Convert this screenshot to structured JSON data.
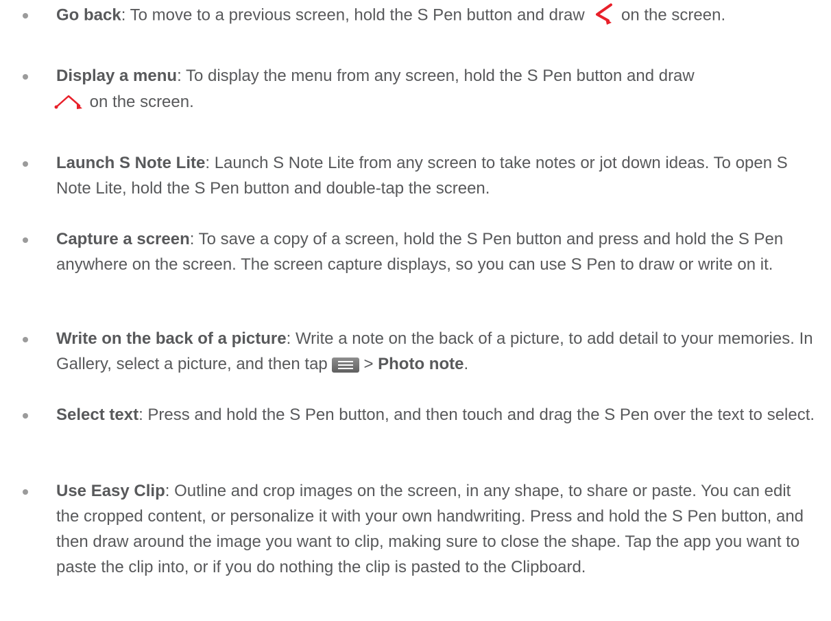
{
  "items": [
    {
      "term": "Go back",
      "text_before_icon": ": To move to a previous screen, hold the S Pen button and draw ",
      "icon": "back-gesture-icon",
      "text_after_icon": "on the screen."
    },
    {
      "term": "Display a menu",
      "text_before_icon": ": To display the menu from any screen, hold the S Pen button and draw",
      "icon": "menu-gesture-icon",
      "text_after_icon": " on the screen."
    },
    {
      "term": "Launch S Note Lite",
      "text": ": Launch S Note Lite from any screen to take notes or jot down ideas. To open S Note Lite, hold the S Pen button and double-tap the screen."
    },
    {
      "term": "Capture a screen",
      "text": ": To save a copy of a screen, hold the S Pen button and press and hold the S Pen anywhere on the screen. The screen capture displays, so you can use S Pen to draw or write on it."
    },
    {
      "term": "Write on the back of a picture",
      "text_before_icon": ": Write a note on the back of a picture, to add detail to your memories. In Gallery, select a picture, and then tap ",
      "icon": "menu-key-icon",
      "text_after_icon": "> ",
      "term2": "Photo note",
      "text_end": "."
    },
    {
      "term": "Select text",
      "text": ": Press and hold the S Pen button, and then touch and drag the S Pen over the text to select."
    },
    {
      "term": "Use Easy Clip",
      "text": ": Outline and crop images on the screen, in any shape, to share or paste. You can edit the cropped content, or personalize it with your own handwriting. Press and hold the S Pen button, and then draw around the image you want to clip, making sure to close the shape. Tap the app you want to paste the clip into, or if you do nothing the clip is pasted to the Clipboard."
    }
  ],
  "colors": {
    "text": "#58595b",
    "gesture_red": "#e8202a",
    "bullet": "#9b9b9b"
  }
}
